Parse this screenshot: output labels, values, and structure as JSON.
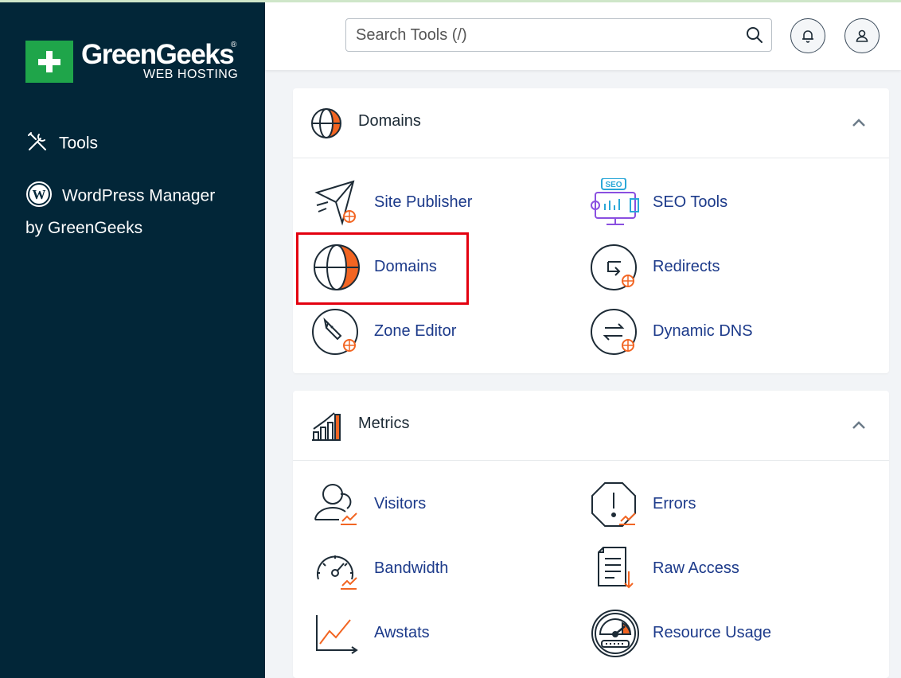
{
  "brand": {
    "name": "GreenGeeks",
    "registered": "®",
    "subtitle": "WEB HOSTING",
    "color": "#1fa54a"
  },
  "sidebar": {
    "items": [
      {
        "label": "Tools",
        "icon": "tools-icon"
      },
      {
        "label": "WordPress Manager",
        "label_line2": "by GreenGeeks",
        "icon": "wordpress-icon"
      }
    ]
  },
  "header": {
    "search": {
      "placeholder": "Search Tools (/)",
      "value": ""
    },
    "notifications_icon": "bell-icon",
    "user_icon": "user-icon"
  },
  "sections": {
    "domains": {
      "title": "Domains",
      "tools": [
        {
          "label": "Site Publisher",
          "icon": "site-publisher-icon"
        },
        {
          "label": "SEO Tools",
          "icon": "seo-tools-icon"
        },
        {
          "label": "Domains",
          "icon": "globe-icon",
          "highlighted": true
        },
        {
          "label": "Redirects",
          "icon": "redirects-icon"
        },
        {
          "label": "Zone Editor",
          "icon": "zone-editor-icon"
        },
        {
          "label": "Dynamic DNS",
          "icon": "dynamic-dns-icon"
        }
      ]
    },
    "metrics": {
      "title": "Metrics",
      "tools": [
        {
          "label": "Visitors",
          "icon": "visitors-icon"
        },
        {
          "label": "Errors",
          "icon": "errors-icon"
        },
        {
          "label": "Bandwidth",
          "icon": "bandwidth-icon"
        },
        {
          "label": "Raw Access",
          "icon": "raw-access-icon"
        },
        {
          "label": "Awstats",
          "icon": "awstats-icon"
        },
        {
          "label": "Resource Usage",
          "icon": "resource-usage-icon"
        }
      ]
    }
  },
  "colors": {
    "sidebar_bg": "#022638",
    "link": "#1c3a8a",
    "accent": "#f26522",
    "highlight": "#e3000f"
  }
}
